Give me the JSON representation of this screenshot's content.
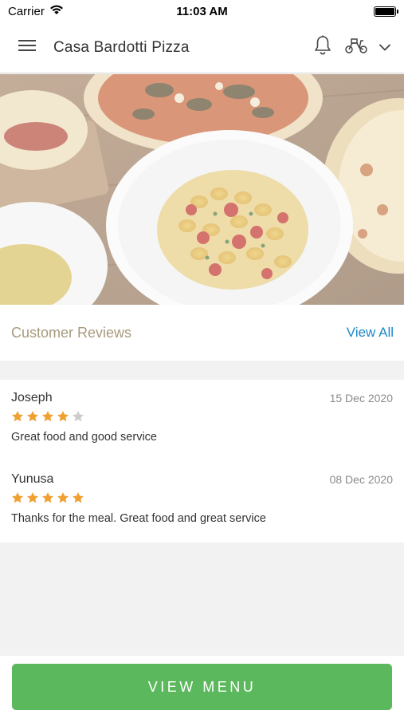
{
  "status_bar": {
    "carrier": "Carrier",
    "time": "11:03 AM"
  },
  "header": {
    "title": "Casa Bardotti Pizza",
    "icons": [
      "menu-icon",
      "bell-icon",
      "scooter-icon",
      "chevron-down-icon"
    ]
  },
  "hero": {
    "description_icon": "food-photo"
  },
  "reviews": {
    "title": "Customer Reviews",
    "view_all_label": "View All",
    "items": [
      {
        "name": "Joseph",
        "date": "15 Dec 2020",
        "rating": 4,
        "max_rating": 5,
        "text": "Great food and good service"
      },
      {
        "name": "Yunusa",
        "date": "08 Dec 2020",
        "rating": 5,
        "max_rating": 5,
        "text": "Thanks for the meal. Great food and great service"
      }
    ]
  },
  "bottom": {
    "view_menu_label": "VIEW MENU"
  },
  "colors": {
    "accent_green": "#5cb85c",
    "link_blue": "#1e88c8",
    "reviews_title": "#a89a7c",
    "star_filled": "#f0a030",
    "star_empty": "#cccccc"
  }
}
